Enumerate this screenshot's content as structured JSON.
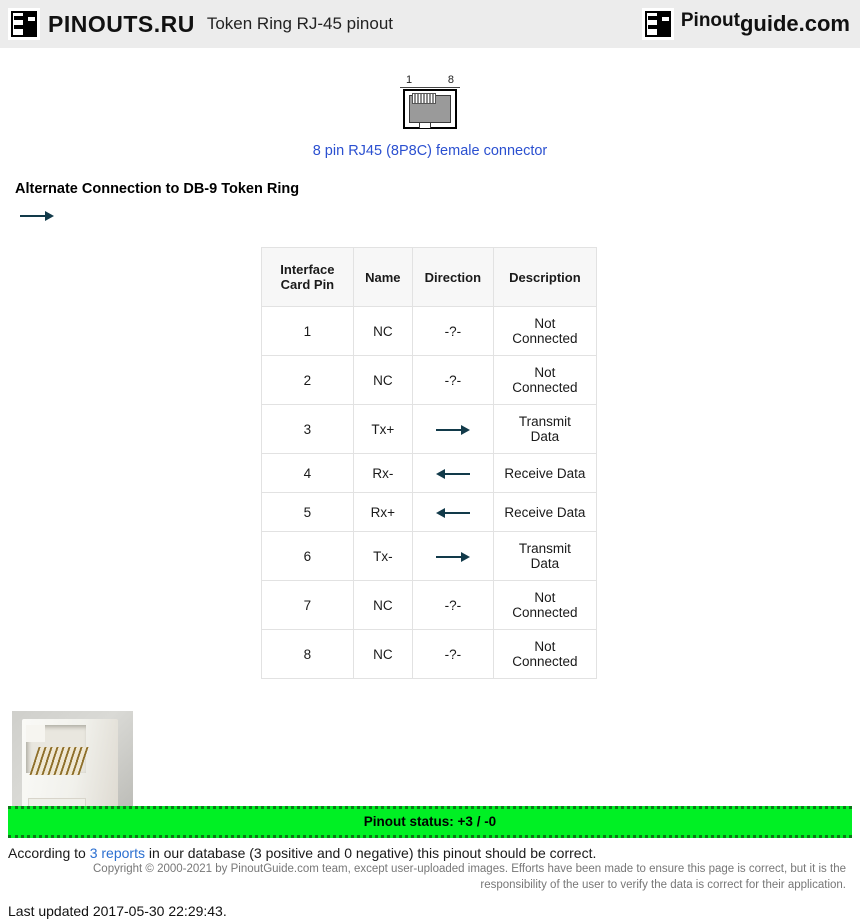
{
  "header": {
    "brand_left": "PINOUTS.RU",
    "page_title": "Token Ring RJ-45 pinout",
    "brand_right_top": "Pinout",
    "brand_right_bottom": "guide.com",
    "logo_icon": "connector-logo-icon"
  },
  "connector": {
    "pin_left_label": "1",
    "pin_right_label": "8",
    "caption": "8 pin RJ45 (8P8C) female connector"
  },
  "section": {
    "heading": "Alternate Connection to DB-9 Token Ring",
    "lead_arrow": "arrow-right-icon"
  },
  "table": {
    "columns": [
      "Interface Card Pin",
      "Name",
      "Direction",
      "Description"
    ],
    "rows": [
      {
        "pin": "1",
        "name": "NC",
        "direction": "-?-",
        "direction_icon": "none",
        "description": "Not Connected"
      },
      {
        "pin": "2",
        "name": "NC",
        "direction": "-?-",
        "direction_icon": "none",
        "description": "Not Connected"
      },
      {
        "pin": "3",
        "name": "Tx+",
        "direction": "",
        "direction_icon": "arrow-right",
        "description": "Transmit Data"
      },
      {
        "pin": "4",
        "name": "Rx-",
        "direction": "",
        "direction_icon": "arrow-left",
        "description": "Receive Data"
      },
      {
        "pin": "5",
        "name": "Rx+",
        "direction": "",
        "direction_icon": "arrow-left",
        "description": "Receive Data"
      },
      {
        "pin": "6",
        "name": "Tx-",
        "direction": "",
        "direction_icon": "arrow-right",
        "description": "Transmit Data"
      },
      {
        "pin": "7",
        "name": "NC",
        "direction": "-?-",
        "direction_icon": "none",
        "description": "Not Connected"
      },
      {
        "pin": "8",
        "name": "NC",
        "direction": "-?-",
        "direction_icon": "none",
        "description": "Not Connected"
      }
    ]
  },
  "photo": {
    "alt": "rj45-female-jack-photo"
  },
  "status": {
    "bar_text": "Pinout status: +3 / -0",
    "note_prefix": "According to ",
    "note_link": "3 reports",
    "note_suffix": " in our database (3 positive and 0 negative) this pinout should be correct.",
    "bar_color": "#00f024",
    "link_color": "#2b6fd0"
  },
  "footer": {
    "copyright": "Copyright © 2000-2021 by PinoutGuide.com team, except user-uploaded images. Efforts have been made to ensure this page is correct, but it is the responsibility of the user to verify the data is correct for their application.",
    "last_updated": "Last updated 2017-05-30 22:29:43."
  }
}
